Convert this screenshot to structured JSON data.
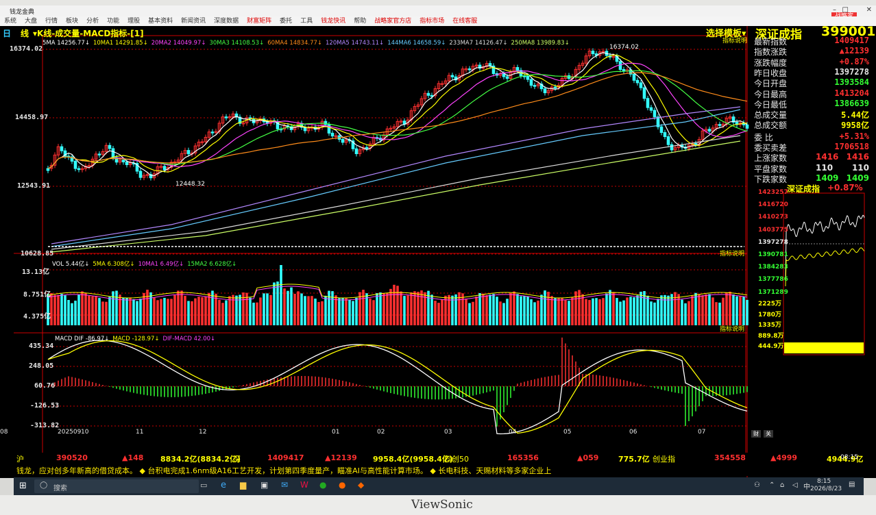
{
  "window": {
    "app_title": "钱龙金典",
    "badge": "战略家"
  },
  "menu": [
    "系统",
    "大盘",
    "行情",
    "板块",
    "分析",
    "功能",
    "理股",
    "基本资料",
    "新闻资讯",
    "深度数据",
    "财富矩阵",
    "委托",
    "工具",
    "钱龙快讯",
    "帮助",
    "战略家官方店",
    "指标市场",
    "在线客服"
  ],
  "chart_header": {
    "period": "日",
    "period_suffix": "线",
    "title": "K线-成交量-MACD指标-[1]",
    "template": "选择模板",
    "index_name": "深证成指",
    "index_code": "399001",
    "indicator_note": "指标说明"
  },
  "ma_legend": [
    {
      "label": "5MA 14256.77",
      "color": "#ffffff"
    },
    {
      "label": "10MA1 14291.85",
      "color": "#ffff00"
    },
    {
      "label": "20MA2 14049.97",
      "color": "#ff44ff"
    },
    {
      "label": "30MA3 14108.53",
      "color": "#44ff44"
    },
    {
      "label": "60MA4 14834.77",
      "color": "#ff8c1a"
    },
    {
      "label": "120MA5 14743.11",
      "color": "#b388ff"
    },
    {
      "label": "144MA6 14658.59",
      "color": "#66ccff"
    },
    {
      "label": "233MA7 14126.47",
      "color": "#dddddd"
    },
    {
      "label": "250MA8 13989.83",
      "color": "#ccff66"
    }
  ],
  "price_axis": [
    "16374.02",
    "14458.97",
    "12543.91",
    "10628.85"
  ],
  "price_annotations": {
    "high": "16374.02",
    "low": "12448.32"
  },
  "volume_legend": [
    {
      "label": "VOL 5.44亿",
      "color": "#ffffff"
    },
    {
      "label": "5MA 6.308亿",
      "color": "#ffff00"
    },
    {
      "label": "10MA1 6.49亿",
      "color": "#ff44ff"
    },
    {
      "label": "15MA2 6.628亿",
      "color": "#44ff44"
    }
  ],
  "volume_axis": [
    "13.13亿",
    "8.751亿",
    "4.375亿"
  ],
  "macd_legend": [
    {
      "label": "MACD DIF -86.97",
      "color": "#ffffff"
    },
    {
      "label": "MACD -128.97",
      "color": "#ffff00"
    },
    {
      "label": "DIF-MACD 42.00",
      "color": "#ff44ff"
    }
  ],
  "macd_axis": [
    "435.34",
    "248.05",
    "60.76",
    "-126.53",
    "-313.82"
  ],
  "time_axis": [
    "202509",
    "10",
    "11",
    "12",
    "01",
    "02",
    "03",
    "04",
    "05",
    "06",
    "07",
    "08"
  ],
  "quote": {
    "rows": [
      {
        "label": "最新指数",
        "value": "1409417",
        "color": "#ff3030"
      },
      {
        "label": "指数涨跌",
        "value": "▲12139",
        "color": "#ff3030"
      },
      {
        "label": "涨跌幅度",
        "value": "+0.87%",
        "color": "#ff3030"
      },
      {
        "label": "昨日收盘",
        "value": "1397278",
        "color": "#e6e6e6"
      },
      {
        "label": "今日开盘",
        "value": "1393584",
        "color": "#33ff33"
      },
      {
        "label": "今日最高",
        "value": "1413204",
        "color": "#ff3030"
      },
      {
        "label": "今日最低",
        "value": "1386639",
        "color": "#33ff33"
      },
      {
        "label": "总成交量",
        "value": "5.44亿",
        "color": "#ffff00"
      },
      {
        "label": "总成交额",
        "value": "9958亿",
        "color": "#ffff00"
      }
    ],
    "commission_ratio": {
      "label": "委 比",
      "value": "+5.31%"
    },
    "commission_diff": {
      "label": "委买卖差",
      "value": "1706518"
    },
    "breadth": [
      {
        "label": "上涨家数",
        "a": "1416",
        "b": "1416",
        "color": "#ff3030"
      },
      {
        "label": "平盘家数",
        "a": "110",
        "b": "110",
        "color": "#e6e6e6"
      },
      {
        "label": "下跌家数",
        "a": "1409",
        "b": "1409",
        "color": "#33ff33"
      }
    ]
  },
  "mini_chart": {
    "title": "深证成指",
    "change": "+0.87%",
    "price_ticks": [
      "1423257",
      "1416720",
      "1410273",
      "1403775",
      "1397278",
      "1390781",
      "1384283",
      "1377786",
      "1371289"
    ],
    "vol_ticks": [
      "2225万",
      "1780万",
      "1335万",
      "889.8万",
      "444.9万"
    ],
    "tabs": [
      "财",
      "关"
    ]
  },
  "ticker1": {
    "sh_label": "沪",
    "sh_value": "390520",
    "sh_change": "▲148",
    "sh_amount": "8834.2亿(8834.2亿)",
    "sz_label": "深",
    "sz_value": "1409417",
    "sz_change": "▲12139",
    "sz_amount": "9958.4亿(9958.4亿)",
    "kc_label": "科创50",
    "kc_value": "165356",
    "kc_change": "▲059",
    "kc_amount": "775.7亿",
    "cy_label": "创业指",
    "cy_value": "354558",
    "cy_change": "▲4999",
    "cy_amount": "4944.9亿",
    "time": "08:15"
  },
  "ticker2": "钱龙，应对创多年新高的借贷成本。 ◆ 台积电完成1.6nm级A16工艺开发，计划第四季度量产，瞄准AI与高性能计算市场。 ◆ 长电科技、天赐材料等多家企业上",
  "taskbar": {
    "search": "搜索",
    "clock": "8:15",
    "date": "2026/8/23",
    "ime": "中"
  },
  "bezel": {
    "brand": "ViewSonic"
  }
}
